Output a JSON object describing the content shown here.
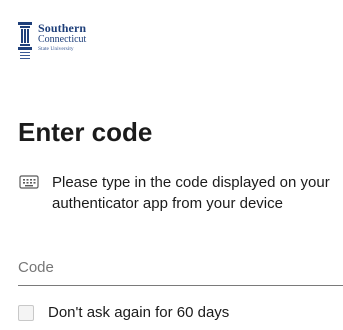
{
  "brand": {
    "line1": "Southern",
    "line2": "Connecticut",
    "line3": "State University",
    "color": "#1e3f7a"
  },
  "page": {
    "title": "Enter code"
  },
  "info": {
    "icon": "keyboard-icon",
    "text": "Please type in the code displayed on your authenticator app from your device"
  },
  "code_input": {
    "placeholder": "Code",
    "value": ""
  },
  "remember": {
    "label": "Don't ask again for 60 days",
    "checked": false
  }
}
